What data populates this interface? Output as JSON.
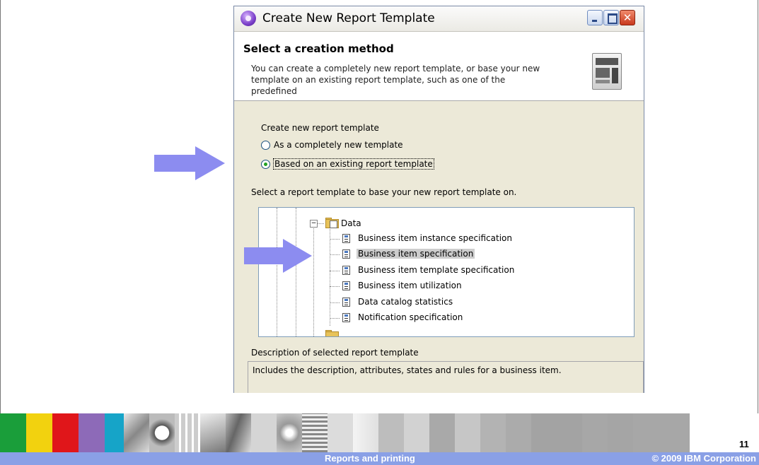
{
  "dialog": {
    "title": "Create New Report Template",
    "header": {
      "title": "Select a creation method",
      "description": "You can create a completely new report template, or base your new template on an existing report template, such as one of the predefined"
    },
    "creation": {
      "group_label": "Create new report template",
      "options": [
        {
          "label": "As a completely new template",
          "selected": false
        },
        {
          "label": "Based on an existing report template",
          "selected": true
        }
      ]
    },
    "select_label": "Select a report template to base your new report template on.",
    "tree": {
      "folder": "Data",
      "expander": "−",
      "items": [
        {
          "label": "Business item instance specification",
          "selected": false
        },
        {
          "label": "Business item specification",
          "selected": true
        },
        {
          "label": "Business item template specification",
          "selected": false
        },
        {
          "label": "Business item utilization",
          "selected": false
        },
        {
          "label": "Data catalog statistics",
          "selected": false
        },
        {
          "label": "Notification specification",
          "selected": false
        }
      ]
    },
    "description_label": "Description of selected report template",
    "description_text": "Includes the description, attributes, states and rules for a business item."
  },
  "window_controls": {
    "close": "✕"
  },
  "footer": {
    "page_number": "11",
    "title": "Reports and printing",
    "copyright": "© 2009 IBM Corporation"
  },
  "colors": {
    "arrow": "#8c8cf0",
    "footer_bar": "#8aa0e6",
    "strip": [
      "#1a9e3a",
      "#f2d20f",
      "#e0161a",
      "#8d6ab8",
      "#16a4c8"
    ]
  }
}
